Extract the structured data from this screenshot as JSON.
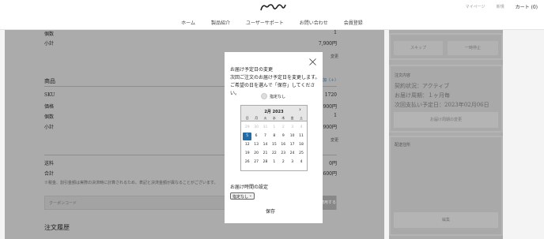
{
  "header": {
    "logo_text": "natori",
    "top_links": [
      "マイページ",
      "新規"
    ],
    "cart": "カート (0)",
    "nav": [
      "ホーム",
      "製品紹介",
      "ユーザーサポート",
      "お問い合わせ",
      "会員登録"
    ]
  },
  "order_summary": {
    "rows_top": [
      {
        "label": "個数",
        "value": "1"
      },
      {
        "label": "小計",
        "value": "7,900円"
      }
    ],
    "change_link": "変更",
    "products_title": "商品",
    "products_link": "追加（＋）",
    "rows_mid": [
      {
        "label": "SKU",
        "value": "1720"
      },
      {
        "label": "価格",
        "value": "7,900円"
      },
      {
        "label": "個数",
        "value": "1"
      },
      {
        "label": "小計",
        "value": "7,900円"
      }
    ],
    "change_link_2": "変更",
    "rows_bottom": [
      {
        "label": "送料",
        "value": "0円"
      },
      {
        "label": "合計",
        "value": "7,600円"
      }
    ],
    "note": "※税金、割引金額は実際の決済時に計算されるため、表記と決済金額が異なることがございます。",
    "coupon_placeholder": "クーポンコード",
    "coupon_button": "適用する",
    "history_title": "注文履歴"
  },
  "sidebar": {
    "skip_button": "スキップ",
    "pause_button": "一時停止",
    "contract_title": "注文内容",
    "contract_status": "契約状況：アクティブ",
    "cycle": "お届け周期：１ヶ月毎",
    "next_payment": "次回支払い予定日：2023年02月06日",
    "change_cycle_button": "お届け周期の変更",
    "shipping_title": "配送住所",
    "edit_button": "編集"
  },
  "modal": {
    "title_lines": [
      "お届け予定日の変更",
      "次回ご注文のお届け予定日を変更します。",
      "ご希望の日を選んで「保存」してください。"
    ],
    "radio_label": "指定なし",
    "calendar": {
      "month": "2月 2023",
      "next": "›",
      "dows": [
        "日",
        "月",
        "火",
        "水",
        "木",
        "金",
        "土"
      ],
      "weeks": [
        [
          "29",
          "30",
          "31",
          "1",
          "2",
          "3",
          "4"
        ],
        [
          "5",
          "6",
          "7",
          "8",
          "9",
          "10",
          "11"
        ],
        [
          "12",
          "13",
          "14",
          "15",
          "16",
          "17",
          "18"
        ],
        [
          "19",
          "20",
          "21",
          "22",
          "23",
          "24",
          "25"
        ],
        [
          "26",
          "27",
          "28",
          "1",
          "2",
          "3",
          "4"
        ]
      ],
      "selected": "5"
    },
    "time_label": "お届け時間の設定",
    "time_select_value": "指定なし",
    "save_button": "保存"
  },
  "colors": {
    "accent": "#1f6ca8",
    "overlay": "#ababab"
  }
}
